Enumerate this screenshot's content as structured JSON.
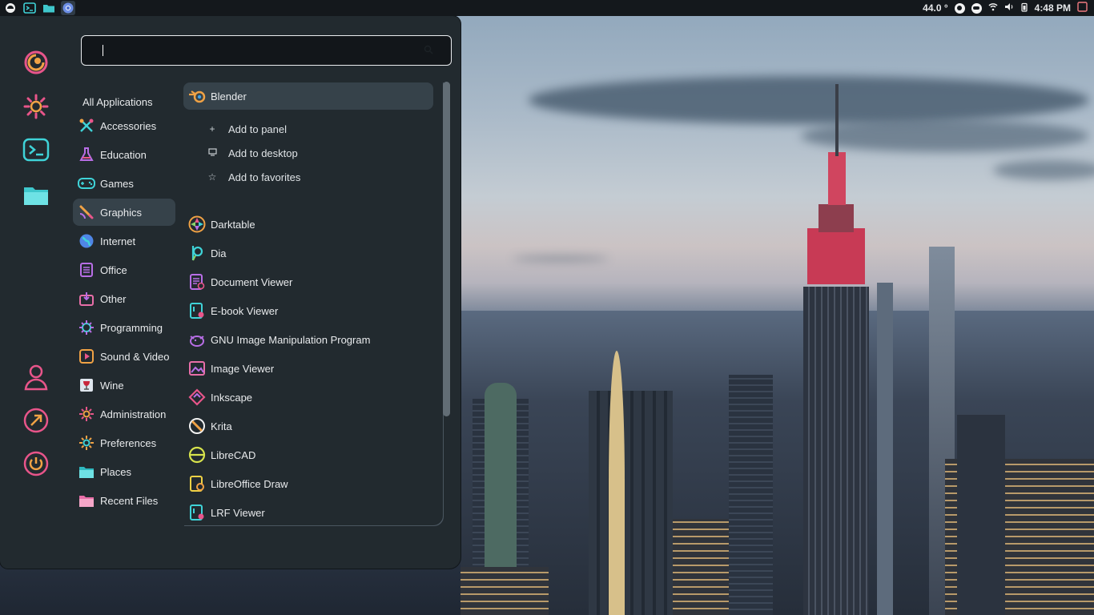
{
  "top_panel": {
    "left_icons": [
      {
        "icon": "menu-logo-icon"
      },
      {
        "icon": "terminal-icon"
      },
      {
        "icon": "folder-icon"
      },
      {
        "icon": "chromium-icon"
      }
    ],
    "temperature": "44.0 °",
    "clock": "4:48 PM"
  },
  "side_strip": {
    "top_items": [
      "app-logo-icon",
      "settings-icon",
      "terminal-icon",
      "files-icon"
    ],
    "bottom_items": [
      "user-icon",
      "logout-icon",
      "power-icon"
    ]
  },
  "search": {
    "value": "",
    "placeholder": ""
  },
  "categories": {
    "header": "All Applications",
    "items": [
      {
        "label": "Accessories",
        "icon": "accessories-icon"
      },
      {
        "label": "Education",
        "icon": "education-icon"
      },
      {
        "label": "Games",
        "icon": "games-icon"
      },
      {
        "label": "Graphics",
        "icon": "graphics-icon",
        "selected": true
      },
      {
        "label": "Internet",
        "icon": "internet-icon"
      },
      {
        "label": "Office",
        "icon": "office-icon"
      },
      {
        "label": "Other",
        "icon": "other-icon"
      },
      {
        "label": "Programming",
        "icon": "programming-icon"
      },
      {
        "label": "Sound & Video",
        "icon": "sound-video-icon"
      },
      {
        "label": "Wine",
        "icon": "wine-icon"
      },
      {
        "label": "Administration",
        "icon": "administration-icon"
      },
      {
        "label": "Preferences",
        "icon": "preferences-icon"
      },
      {
        "label": "Places",
        "icon": "places-icon"
      },
      {
        "label": "Recent Files",
        "icon": "recent-files-icon"
      }
    ]
  },
  "apps": {
    "selected": {
      "label": "Blender",
      "icon": "blender-icon"
    },
    "context_menu": [
      {
        "label": "Add to panel",
        "icon": "plus-icon"
      },
      {
        "label": "Add to desktop",
        "icon": "desktop-icon"
      },
      {
        "label": "Add to favorites",
        "icon": "star-icon"
      }
    ],
    "items": [
      {
        "label": "Darktable",
        "icon": "darktable-icon"
      },
      {
        "label": "Dia",
        "icon": "dia-icon"
      },
      {
        "label": "Document Viewer",
        "icon": "document-viewer-icon"
      },
      {
        "label": "E-book Viewer",
        "icon": "ebook-viewer-icon"
      },
      {
        "label": "GNU Image Manipulation Program",
        "icon": "gimp-icon"
      },
      {
        "label": "Image Viewer",
        "icon": "image-viewer-icon"
      },
      {
        "label": "Inkscape",
        "icon": "inkscape-icon"
      },
      {
        "label": "Krita",
        "icon": "krita-icon"
      },
      {
        "label": "LibreCAD",
        "icon": "librecad-icon"
      },
      {
        "label": "LibreOffice Draw",
        "icon": "libreoffice-draw-icon"
      },
      {
        "label": "LRF Viewer",
        "icon": "lrf-viewer-icon"
      }
    ]
  },
  "colors": {
    "menu_bg": "#222a2f",
    "selected_bg": "#36424a",
    "panel_bg": "#14181c",
    "icon_cyan": "#3fd3d8",
    "icon_pink": "#e8558a",
    "icon_orange": "#f0a245"
  }
}
